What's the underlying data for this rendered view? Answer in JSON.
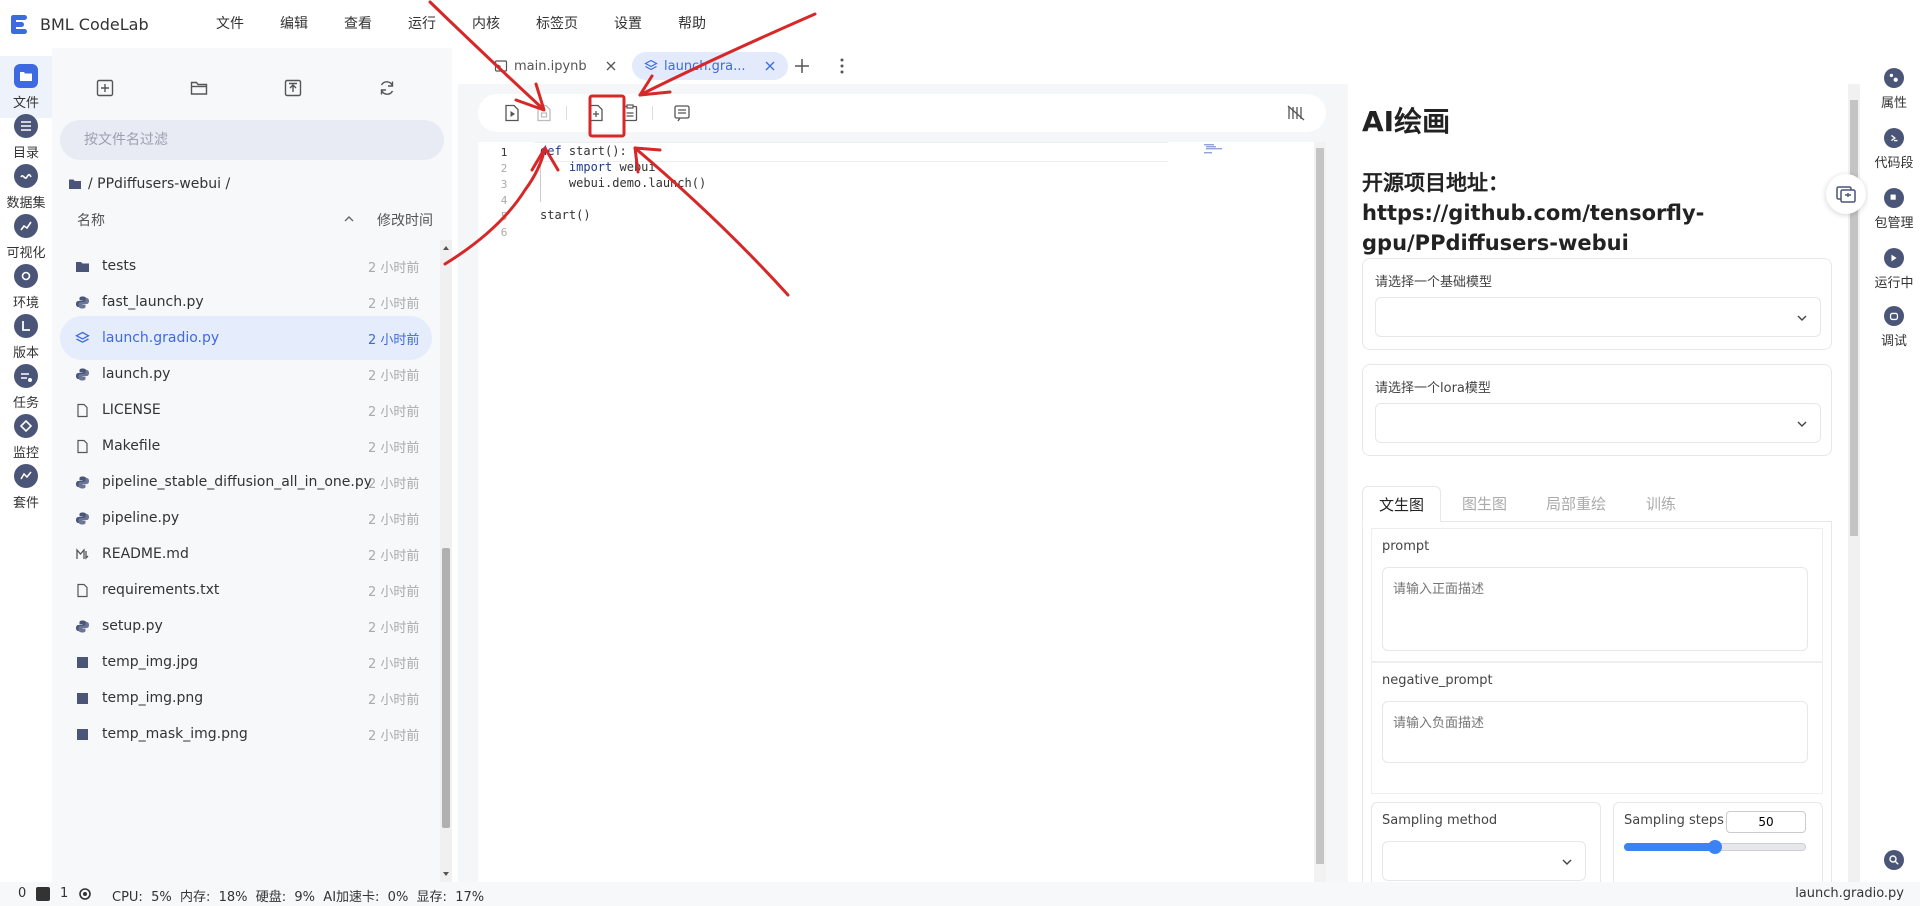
{
  "app": {
    "brand": "BML CodeLab",
    "accent_color": "#3e6ae1"
  },
  "menu": [
    "文件",
    "编辑",
    "查看",
    "运行",
    "内核",
    "标签页",
    "设置",
    "帮助"
  ],
  "activity": [
    {
      "label": "文件",
      "icon": "folder-icon",
      "active": true
    },
    {
      "label": "目录",
      "icon": "list-icon"
    },
    {
      "label": "数据集",
      "icon": "dataset-icon"
    },
    {
      "label": "可视化",
      "icon": "chart-icon"
    },
    {
      "label": "环境",
      "icon": "environment-icon"
    },
    {
      "label": "版本",
      "icon": "version-icon"
    },
    {
      "label": "任务",
      "icon": "task-icon"
    },
    {
      "label": "监控",
      "icon": "monitor-icon"
    },
    {
      "label": "套件",
      "icon": "suite-icon"
    }
  ],
  "file_panel": {
    "filter_placeholder": "按文件名过滤",
    "breadcrumb": "/ PPdiffusers-webui /",
    "col_name": "名称",
    "col_time": "修改时间",
    "files": [
      {
        "name": "tests",
        "type": "folder",
        "time": "2 小时前"
      },
      {
        "name": "fast_launch.py",
        "type": "python",
        "time": "2 小时前"
      },
      {
        "name": "launch.gradio.py",
        "type": "gradio",
        "time": "2 小时前",
        "selected": true
      },
      {
        "name": "launch.py",
        "type": "python",
        "time": "2 小时前"
      },
      {
        "name": "LICENSE",
        "type": "file",
        "time": "2 小时前"
      },
      {
        "name": "Makefile",
        "type": "file",
        "time": "2 小时前"
      },
      {
        "name": "pipeline_stable_diffusion_all_in_one.py",
        "type": "python",
        "time": "2 小时前"
      },
      {
        "name": "pipeline.py",
        "type": "python",
        "time": "2 小时前"
      },
      {
        "name": "README.md",
        "type": "markdown",
        "time": "2 小时前"
      },
      {
        "name": "requirements.txt",
        "type": "file",
        "time": "2 小时前"
      },
      {
        "name": "setup.py",
        "type": "python",
        "time": "2 小时前"
      },
      {
        "name": "temp_img.jpg",
        "type": "image",
        "time": "2 小时前"
      },
      {
        "name": "temp_img.png",
        "type": "image",
        "time": "2 小时前"
      },
      {
        "name": "temp_mask_img.png",
        "type": "image",
        "time": "2 小时前"
      }
    ]
  },
  "tabs": [
    {
      "label": "main.ipynb",
      "icon": "notebook-icon",
      "active": false
    },
    {
      "label": "launch.gra...",
      "icon": "gradio-icon",
      "active": true
    }
  ],
  "editor": {
    "lines": [
      {
        "no": "1",
        "text": "def start():"
      },
      {
        "no": "2",
        "text": "    import webui"
      },
      {
        "no": "3",
        "text": "    webui.demo.launch()"
      },
      {
        "no": "4",
        "text": ""
      },
      {
        "no": "5",
        "text": "start()"
      },
      {
        "no": "6",
        "text": ""
      }
    ]
  },
  "gradio": {
    "title": "AI绘画",
    "project_label": "开源项目地址：",
    "project_url": "https://github.com/tensorfly-gpu/PPdiffusers-webui",
    "base_model_label": "请选择一个基础模型",
    "lora_model_label": "请选择一个lora模型",
    "tabs": [
      "文生图",
      "图生图",
      "局部重绘",
      "训练"
    ],
    "prompt_label": "prompt",
    "prompt_placeholder": "请输入正面描述",
    "negative_prompt_label": "negative_prompt",
    "negative_prompt_placeholder": "请输入负面描述",
    "sampling_method_label": "Sampling method",
    "sampling_steps_label": "Sampling steps",
    "sampling_steps_value": "50",
    "sampling_steps_fraction": 0.5
  },
  "rightbar": [
    {
      "label": "属性",
      "icon": "properties-icon"
    },
    {
      "label": "代码段",
      "icon": "snippet-icon"
    },
    {
      "label": "包管理",
      "icon": "package-icon"
    },
    {
      "label": "运行中",
      "icon": "running-icon"
    },
    {
      "label": "调试",
      "icon": "debug-icon"
    }
  ],
  "status": {
    "left_count": "0",
    "terminal_count": "1",
    "metrics": "CPU:  5%  内存:  18%  硬盘:  9%  AI加速卡:  0%  显存:  17%",
    "current_file": "launch.gradio.py"
  }
}
